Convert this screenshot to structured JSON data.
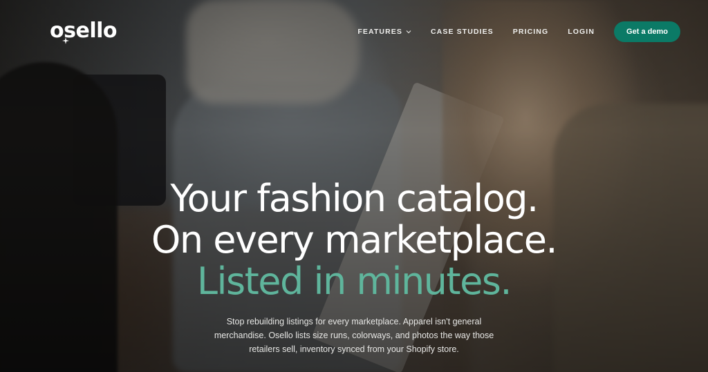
{
  "brand": {
    "name": "osello",
    "accent_color": "#0b7a66",
    "highlight_color": "#5fb59c"
  },
  "nav": {
    "items": [
      {
        "label": "FEATURES",
        "has_dropdown": true,
        "icon": "chevron-down-icon"
      },
      {
        "label": "CASE STUDIES",
        "has_dropdown": false
      },
      {
        "label": "PRICING",
        "has_dropdown": false
      },
      {
        "label": "LOGIN",
        "has_dropdown": false
      }
    ],
    "cta_label": "Get a demo"
  },
  "hero": {
    "line1": "Your fashion catalog.",
    "line2": "On every marketplace.",
    "line3": "Listed in minutes.",
    "subtext": "Stop rebuilding listings for every marketplace. Apparel isn't general merchandise. Osello lists size runs, colorways, and photos the way those retailers sell, inventory synced from your Shopify store."
  }
}
